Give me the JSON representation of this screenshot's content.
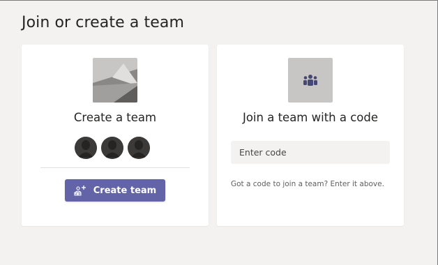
{
  "page": {
    "title": "Join or create a team"
  },
  "create_card": {
    "title": "Create a team",
    "button_label": "Create team",
    "button_icon": "add-team-icon",
    "image_icon": "landscape-placeholder-icon",
    "avatar_icon": "person-silhouette-icon"
  },
  "join_card": {
    "title": "Join a team with a code",
    "input_placeholder": "Enter code",
    "input_value": "",
    "hint": "Got a code to join a team? Enter it above.",
    "image_icon": "team-people-icon"
  },
  "colors": {
    "accent": "#6264a7",
    "background": "#f3f2f1",
    "card": "#ffffff",
    "text": "#252423"
  }
}
